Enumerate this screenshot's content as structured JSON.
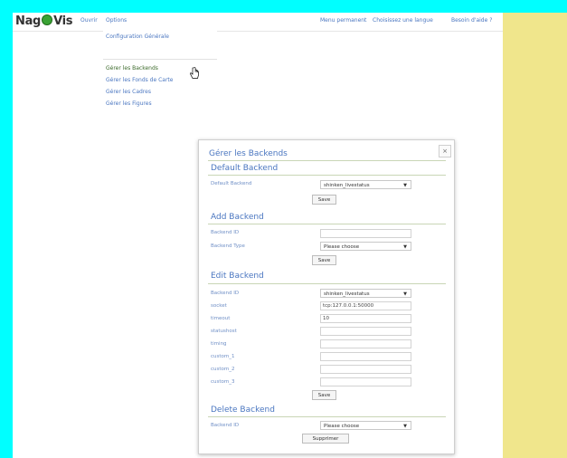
{
  "logo": {
    "text_left": "Nag",
    "text_right": "Vis"
  },
  "nav": {
    "open": "Ouvrir",
    "options": "Options"
  },
  "top_right": {
    "permalink": "Menu permanent",
    "language": "Choisissez une langue",
    "help": "Besoin d'aide ?"
  },
  "menu": {
    "items": [
      "Configuration Générale",
      "Gérer les Backends",
      "Gérer les Fonds de Carte",
      "Gérer les Cadres",
      "Gérer les Figures"
    ]
  },
  "dialog": {
    "title": "Gérer les Backends",
    "close": "×",
    "default": {
      "title": "Default Backend",
      "label": "Default Backend",
      "select_value": "shinken_livestatus",
      "button": "Save"
    },
    "add": {
      "title": "Add Backend",
      "label_id": "Backend ID",
      "label_type": "Backend Type",
      "type_value": "Please choose",
      "button": "Save"
    },
    "edit": {
      "title": "Edit Backend",
      "fields": [
        {
          "label": "Backend ID",
          "value": "shinken_livestatus"
        },
        {
          "label": "socket",
          "value": "tcp:127.0.0.1:50000"
        },
        {
          "label": "timeout",
          "value": "10"
        },
        {
          "label": "statushost",
          "value": ""
        },
        {
          "label": "timing",
          "value": ""
        },
        {
          "label": "custom_1",
          "value": ""
        },
        {
          "label": "custom_2",
          "value": ""
        },
        {
          "label": "custom_3",
          "value": ""
        }
      ],
      "button": "Save"
    },
    "delete": {
      "title": "Delete Backend",
      "label": "Backend ID",
      "select_value": "Please choose",
      "button": "Supprimer"
    }
  }
}
